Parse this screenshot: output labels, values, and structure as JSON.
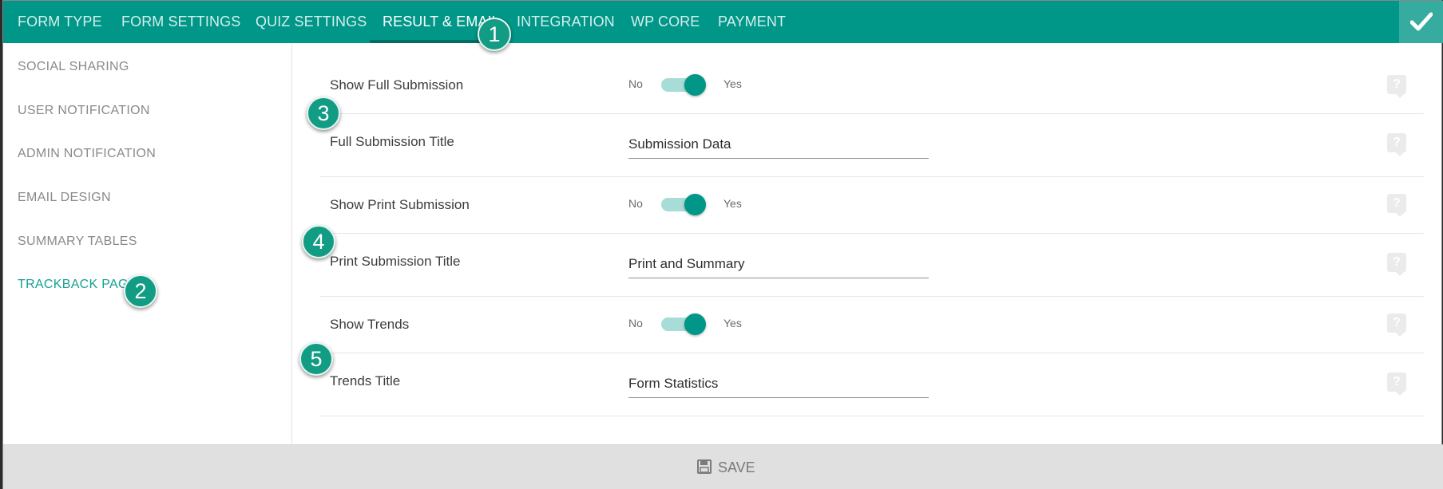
{
  "tabs": [
    {
      "label": "FORM TYPE",
      "active": false
    },
    {
      "label": "FORM SETTINGS",
      "active": false
    },
    {
      "label": "QUIZ SETTINGS",
      "active": false
    },
    {
      "label": "RESULT & EMAIL",
      "active": true
    },
    {
      "label": "INTEGRATION",
      "active": false
    },
    {
      "label": "WP CORE",
      "active": false
    },
    {
      "label": "PAYMENT",
      "active": false
    }
  ],
  "sidebar": {
    "items": [
      {
        "label": "SOCIAL SHARING"
      },
      {
        "label": "USER NOTIFICATION"
      },
      {
        "label": "ADMIN NOTIFICATION"
      },
      {
        "label": "EMAIL DESIGN"
      },
      {
        "label": "SUMMARY TABLES"
      },
      {
        "label": "TRACKBACK PAGE",
        "active": true
      }
    ]
  },
  "settings": {
    "show_full_submission": {
      "label": "Show Full Submission",
      "no": "No",
      "yes": "Yes",
      "value": true
    },
    "full_submission_title": {
      "label": "Full Submission Title",
      "value": "Submission Data"
    },
    "show_print_submission": {
      "label": "Show Print Submission",
      "no": "No",
      "yes": "Yes",
      "value": true
    },
    "print_submission_title": {
      "label": "Print Submission Title",
      "value": "Print and Summary"
    },
    "show_trends": {
      "label": "Show Trends",
      "no": "No",
      "yes": "Yes",
      "value": true
    },
    "trends_title": {
      "label": "Trends Title",
      "value": "Form Statistics"
    }
  },
  "help_icon_text": "?",
  "markers": [
    "1",
    "2",
    "3",
    "4",
    "5"
  ],
  "footer": {
    "save_label": "SAVE"
  },
  "colors": {
    "accent": "#009688",
    "active_text": "#16a093",
    "marker": "#119c83"
  },
  "icons": {
    "confirm": "check-icon",
    "help": "help-icon",
    "save": "floppy-disk-icon"
  }
}
